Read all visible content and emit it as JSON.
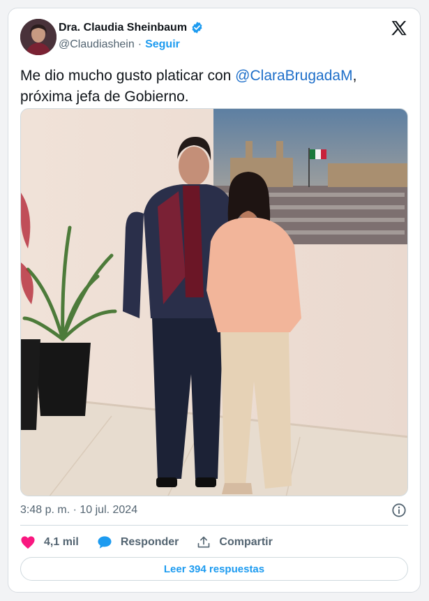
{
  "author": {
    "display_name": "Dra. Claudia Sheinbaum",
    "handle": "@Claudiashein",
    "separator": "·",
    "follow_label": "Seguir"
  },
  "tweet": {
    "text_before": "Me dio mucho gusto platicar con ",
    "mention": "@ClaraBrugadaM",
    "text_after": ",\npróxima jefa de Gobierno."
  },
  "meta": {
    "timestamp": "3:48 p. m. · 10 jul. 2024"
  },
  "actions": {
    "likes": "4,1 mil",
    "reply_label": "Responder",
    "share_label": "Compartir"
  },
  "replies_button": "Leer 394 respuestas",
  "icons": {
    "verified": "verified-badge-icon",
    "x_logo": "x-logo-icon",
    "info": "info-icon",
    "like": "heart-icon",
    "reply": "speech-bubble-icon",
    "share": "share-upload-icon"
  },
  "colors": {
    "accent": "#1d9bf0",
    "mention": "#1d6ec9",
    "heart": "#f91880",
    "muted": "#536471"
  }
}
